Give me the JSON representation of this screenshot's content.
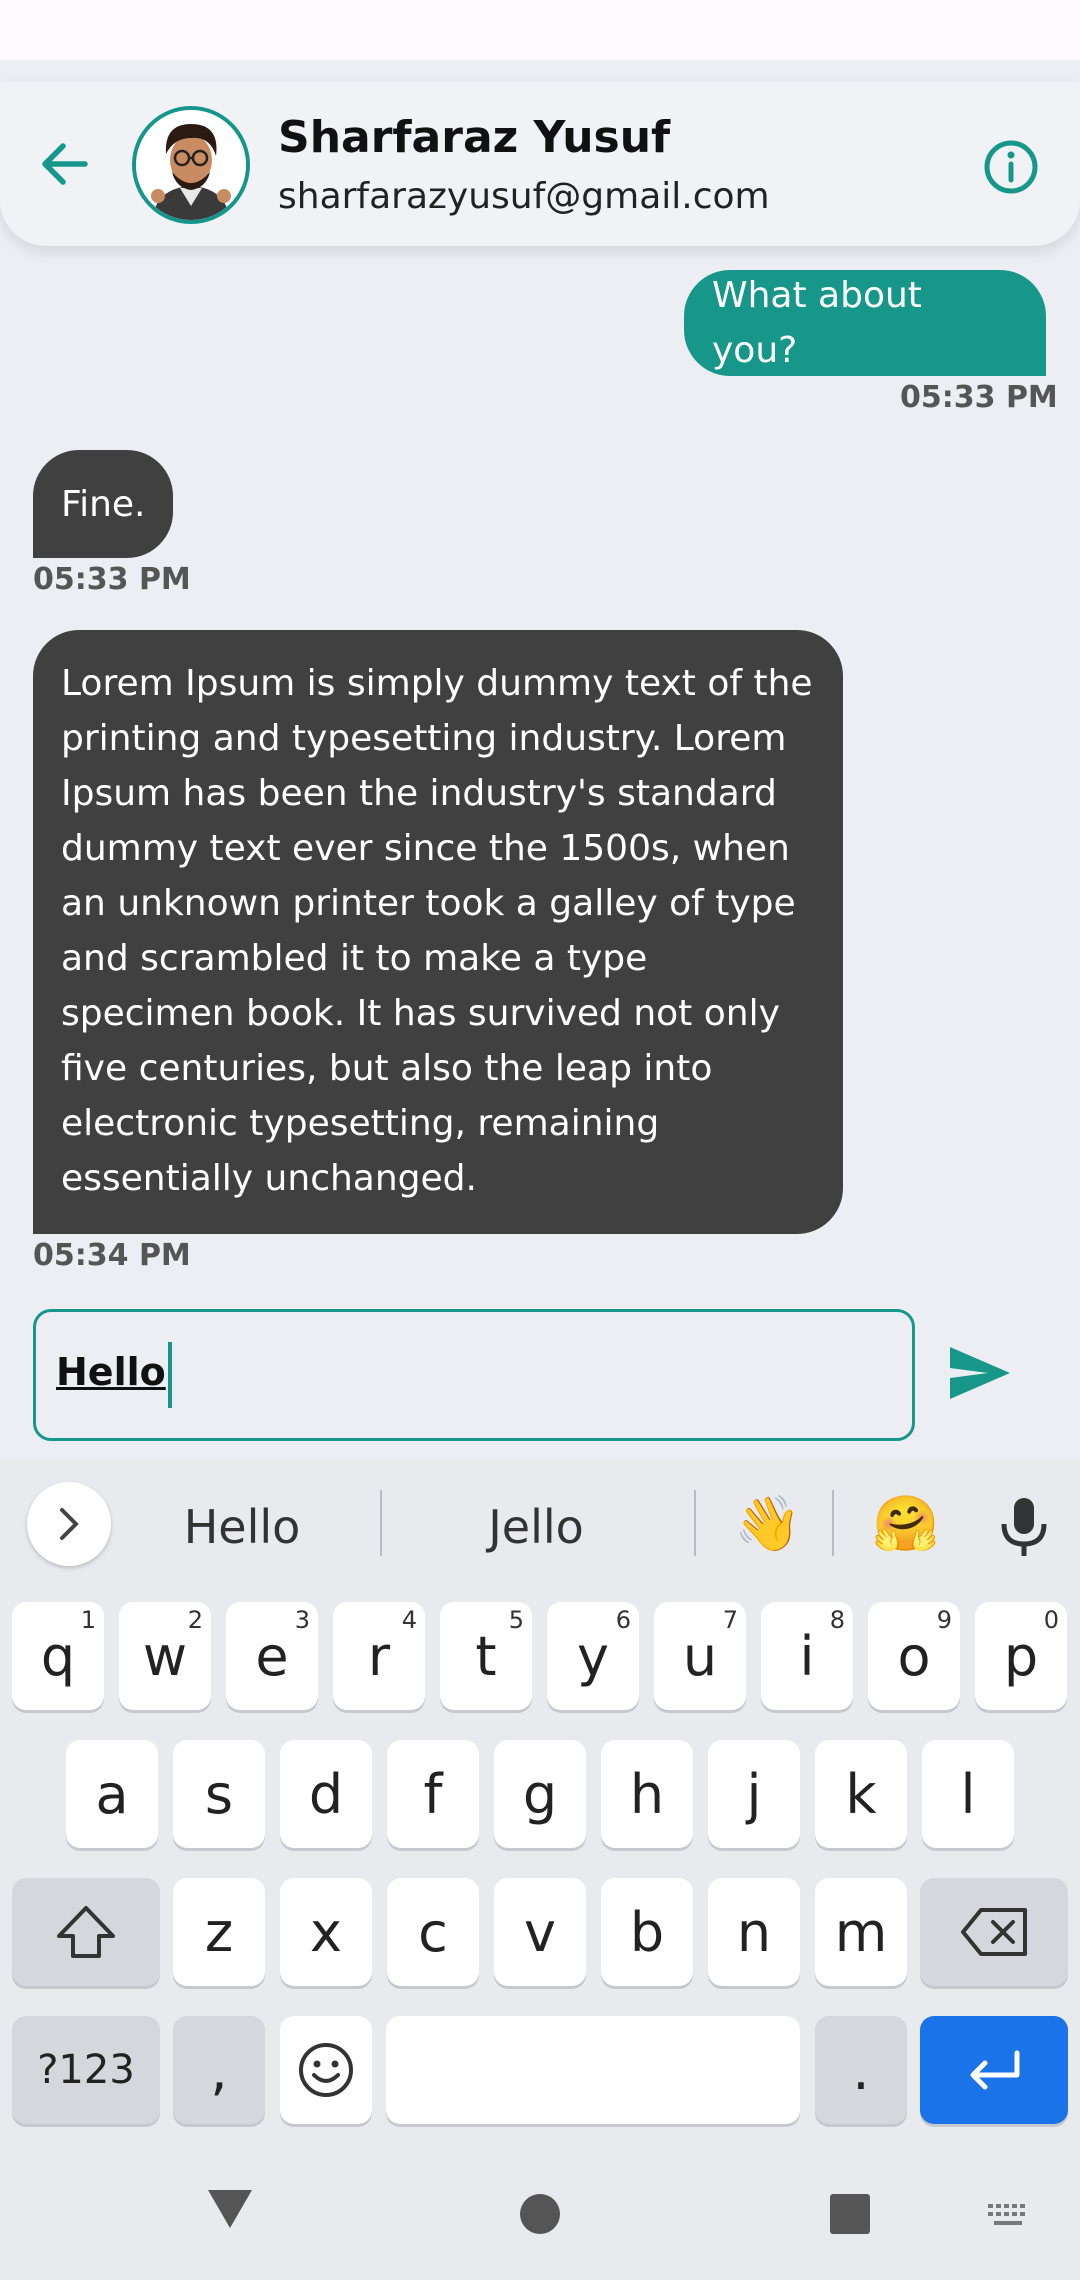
{
  "header": {
    "name": "Sharfaraz Yusuf",
    "email": "sharfarazyusuf@gmail.com"
  },
  "messages": [
    {
      "direction": "outgoing",
      "text": "What about you?",
      "time": "05:33 PM"
    },
    {
      "direction": "incoming",
      "text": "Fine.",
      "time": "05:33 PM"
    },
    {
      "direction": "incoming",
      "text": "Lorem Ipsum is simply dummy text of the printing and typesetting industry. Lorem Ipsum has been the industry's standard dummy text ever since the 1500s, when an unknown printer took a galley of type and scrambled it to make a type specimen book. It has survived not only five centuries, but also the leap into electronic typesetting, remaining essentially unchanged.",
      "time": "05:34 PM"
    }
  ],
  "composer": {
    "value": "Hello"
  },
  "keyboard": {
    "suggestions": [
      "Hello",
      "Jello"
    ],
    "emoji_suggestions": [
      "👋",
      "🤗"
    ],
    "row1": [
      {
        "key": "q",
        "hint": "1"
      },
      {
        "key": "w",
        "hint": "2"
      },
      {
        "key": "e",
        "hint": "3"
      },
      {
        "key": "r",
        "hint": "4"
      },
      {
        "key": "t",
        "hint": "5"
      },
      {
        "key": "y",
        "hint": "6"
      },
      {
        "key": "u",
        "hint": "7"
      },
      {
        "key": "i",
        "hint": "8"
      },
      {
        "key": "o",
        "hint": "9"
      },
      {
        "key": "p",
        "hint": "0"
      }
    ],
    "row2": [
      "a",
      "s",
      "d",
      "f",
      "g",
      "h",
      "j",
      "k",
      "l"
    ],
    "row3": [
      "z",
      "x",
      "c",
      "v",
      "b",
      "n",
      "m"
    ],
    "symbols_label": "?123",
    "comma_label": ",",
    "period_label": "."
  },
  "colors": {
    "accent": "#16978a",
    "incoming_bubble": "#404040",
    "enter_key": "#1a73e8"
  }
}
